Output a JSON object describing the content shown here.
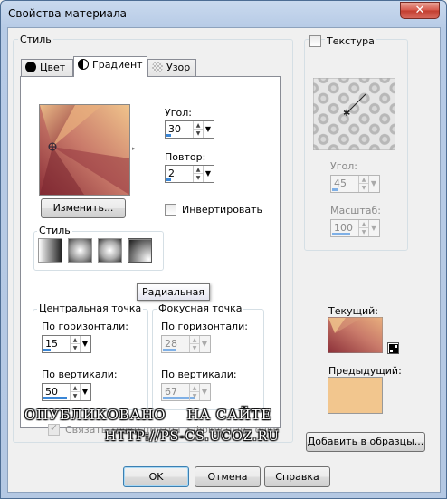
{
  "window": {
    "title": "Свойства материала",
    "close_glyph": "✕"
  },
  "style_group": {
    "label": "Стиль"
  },
  "tabs": [
    {
      "label": "Цвет",
      "icon": "black-circle-icon"
    },
    {
      "label": "Градиент",
      "icon": "half-circle-icon"
    },
    {
      "label": "Узор",
      "icon": "pattern-icon"
    }
  ],
  "gradient": {
    "edit_button": "Изменить...",
    "angle_label": "Угол:",
    "angle_value": "30",
    "repeat_label": "Повтор:",
    "repeat_value": "2",
    "invert_label": "Инвертировать",
    "inner_style_label": "Стиль",
    "style_buttons": [
      "linear-gradient-icon",
      "rectangular-gradient-icon",
      "sunburst-gradient-icon",
      "radial-gradient-icon"
    ],
    "tooltip": "Радиальная",
    "center_group": {
      "label": "Центральная точка",
      "h_label": "По горизонтали:",
      "h_value": "15",
      "v_label": "По вертикали:",
      "v_value": "50"
    },
    "focal_group": {
      "label": "Фокусная точка",
      "h_label": "По горизонтали:",
      "h_value": "28",
      "v_label": "По вертикали:",
      "v_value": "67"
    },
    "link_label": "Связать точку центра и фокусные точки",
    "colors": {
      "dark": "#8b2f38",
      "mid": "#c97a6a",
      "light": "#f0c48c"
    }
  },
  "texture": {
    "checkbox_label": "Текстура",
    "angle_label": "Угол:",
    "angle_value": "45",
    "scale_label": "Масштаб:",
    "scale_value": "100"
  },
  "current": {
    "label": "Текущий:"
  },
  "previous": {
    "label": "Предыдущий:",
    "color": "#f2c68e"
  },
  "watermark": {
    "line1": "ОПУБЛИКОВАНО    НА САЙТЕ",
    "line2": "HTTP://PS-CS.UCOZ.RU"
  },
  "buttons": {
    "add_to_swatches": "Добавить в образцы...",
    "ok": "OK",
    "cancel": "Отмена",
    "help": "Справка"
  }
}
